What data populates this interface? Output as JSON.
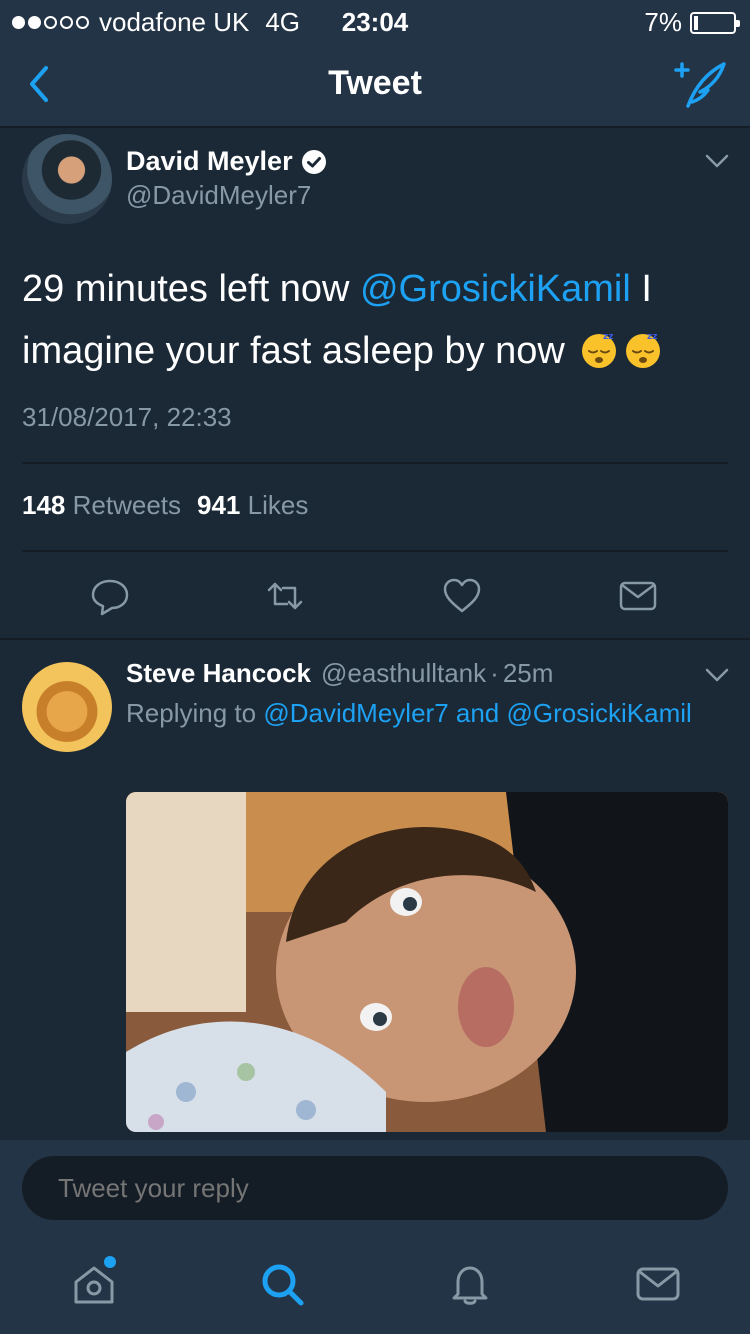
{
  "status_bar": {
    "carrier": "vodafone UK",
    "network": "4G",
    "time": "23:04",
    "battery": "7%",
    "battery_level": 0.07,
    "signal_bars": 2
  },
  "nav": {
    "title": "Tweet",
    "back_icon": "chevron-left-icon",
    "compose_icon": "compose-tweet-icon"
  },
  "tweet": {
    "author_name": "David Meyler",
    "author_handle": "@DavidMeyler7",
    "verified": true,
    "text_before": "29 minutes left now ",
    "mention": "@GrosickiKamil",
    "text_after": " I imagine your fast asleep by now",
    "emojis": [
      "sleeping-face-emoji",
      "sleeping-face-emoji"
    ],
    "date": "31/08/2017, 22:33",
    "retweets_count": "148",
    "retweets_label": "Retweets",
    "likes_count": "941",
    "likes_label": "Likes",
    "actions": [
      "reply-icon",
      "retweet-icon",
      "like-icon",
      "message-icon"
    ]
  },
  "reply": {
    "author_name": "Steve Hancock",
    "author_handle": "@easthulltank",
    "separator": "·",
    "time_ago": "25m",
    "replying_prefix": "Replying to",
    "replying_to_1": "@DavidMeyler7",
    "replying_and": "and",
    "replying_to_2": "@GrosickiKamil"
  },
  "reply_input": {
    "placeholder": "Tweet your reply"
  },
  "tabs": [
    "home-icon",
    "search-icon",
    "notifications-icon",
    "messages-icon"
  ],
  "colors": {
    "background": "#1b2836",
    "bar": "#243447",
    "accent": "#1da1f2",
    "muted": "#8899a6"
  }
}
